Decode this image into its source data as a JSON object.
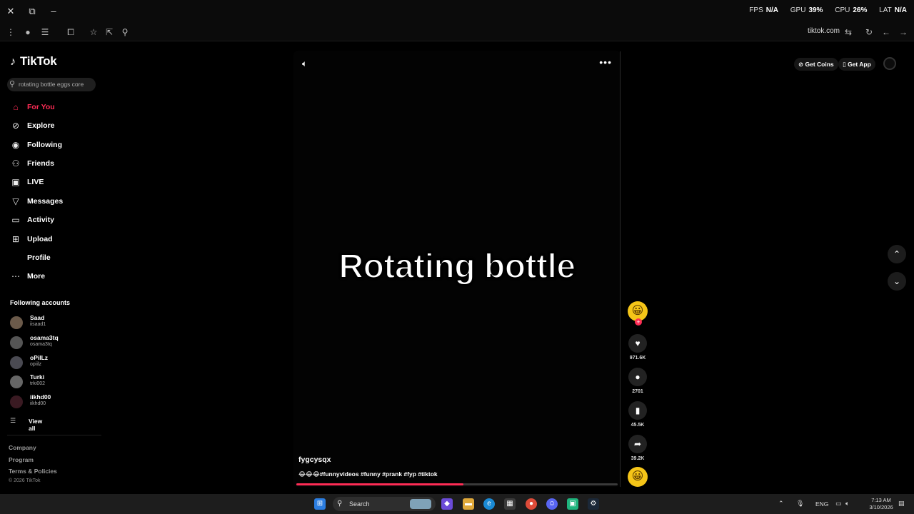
{
  "window": {
    "close_icon": "close-icon",
    "overlay": {
      "fps_label": "FPS",
      "fps_value": "N/A",
      "gpu_label": "GPU",
      "gpu_value": "39%",
      "cpu_label": "CPU",
      "cpu_value": "26%",
      "lat_label": "LAT",
      "lat_value": "N/A"
    }
  },
  "browser": {
    "url": "tiktok.com"
  },
  "sidebar": {
    "logo": "TikTok",
    "search_value": "rotating bottle eggs core",
    "nav": [
      {
        "label": "For You",
        "icon": "home-icon",
        "active": true
      },
      {
        "label": "Explore",
        "icon": "compass-icon"
      },
      {
        "label": "Following",
        "icon": "following-icon"
      },
      {
        "label": "Friends",
        "icon": "friends-icon"
      },
      {
        "label": "LIVE",
        "icon": "live-icon"
      },
      {
        "label": "Messages",
        "icon": "messages-icon"
      },
      {
        "label": "Activity",
        "icon": "activity-icon"
      },
      {
        "label": "Upload",
        "icon": "upload-icon"
      },
      {
        "label": "Profile",
        "icon": "profile-icon"
      },
      {
        "label": "More",
        "icon": "more-icon"
      }
    ],
    "following_heading": "Following accounts",
    "accounts": [
      {
        "name": "Saad",
        "handle": "iisaad1"
      },
      {
        "name": "osama3tq",
        "handle": "osama3tq"
      },
      {
        "name": "oPiILz",
        "handle": "opiilz"
      },
      {
        "name": "Turki",
        "handle": "trki002"
      },
      {
        "name": "iikhd00",
        "handle": "iikhd00"
      }
    ],
    "view_all": "View all",
    "footer": [
      "Company",
      "Program",
      "Terms & Policies"
    ],
    "copyright": "© 2026 TikTok"
  },
  "video": {
    "overlay_text": "Rotating bottle",
    "author": "fygcysqx",
    "caption": "😂😂😂#funnyvideos #funny #prank #fyp #tiktok",
    "progress_percent": 52
  },
  "actions": {
    "likes": "971.6K",
    "comments": "2701",
    "saves": "45.5K",
    "shares": "39.2K"
  },
  "header_right": {
    "get_coins": "Get Coins",
    "get_app": "Get App"
  },
  "taskbar": {
    "search_label": "Search",
    "lang": "ENG",
    "time": "7:13 AM",
    "date": "3/10/2026"
  }
}
